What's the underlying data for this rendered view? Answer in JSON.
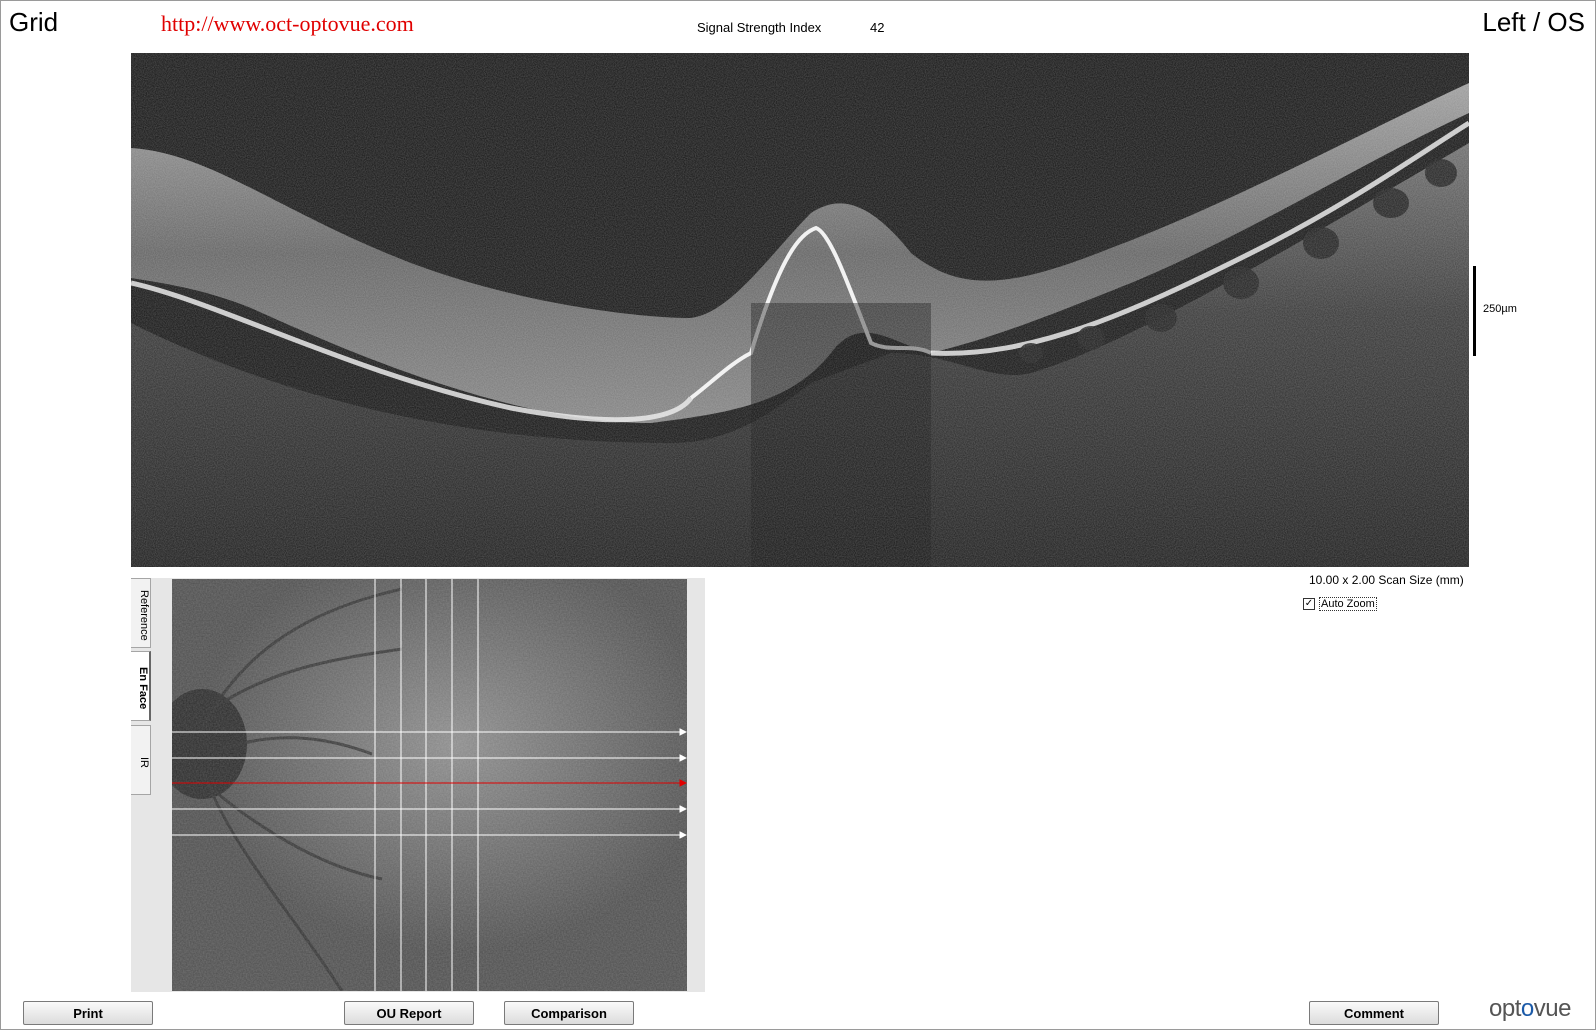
{
  "header": {
    "mode": "Grid",
    "website": "http://www.oct-optovue.com",
    "signal_strength_label": "Signal Strength Index",
    "signal_strength_value": "42",
    "eye": "Left / OS"
  },
  "bscan": {
    "scale_label": "250µm",
    "scan_size": "10.00 x 2.00 Scan Size (mm)",
    "auto_zoom": {
      "checked": true,
      "label": "Auto Zoom"
    }
  },
  "enface": {
    "tabs": [
      "Reference",
      "En Face",
      "IR"
    ],
    "active_tab": "En Face",
    "selected_line_color": "#e00000",
    "line_color": "#ffffff"
  },
  "buttons": {
    "print": "Print",
    "ou_report": "OU Report",
    "comparison": "Comparison",
    "comment": "Comment"
  },
  "logo": {
    "pre": "opt",
    "o": "o",
    "post": "vue"
  }
}
